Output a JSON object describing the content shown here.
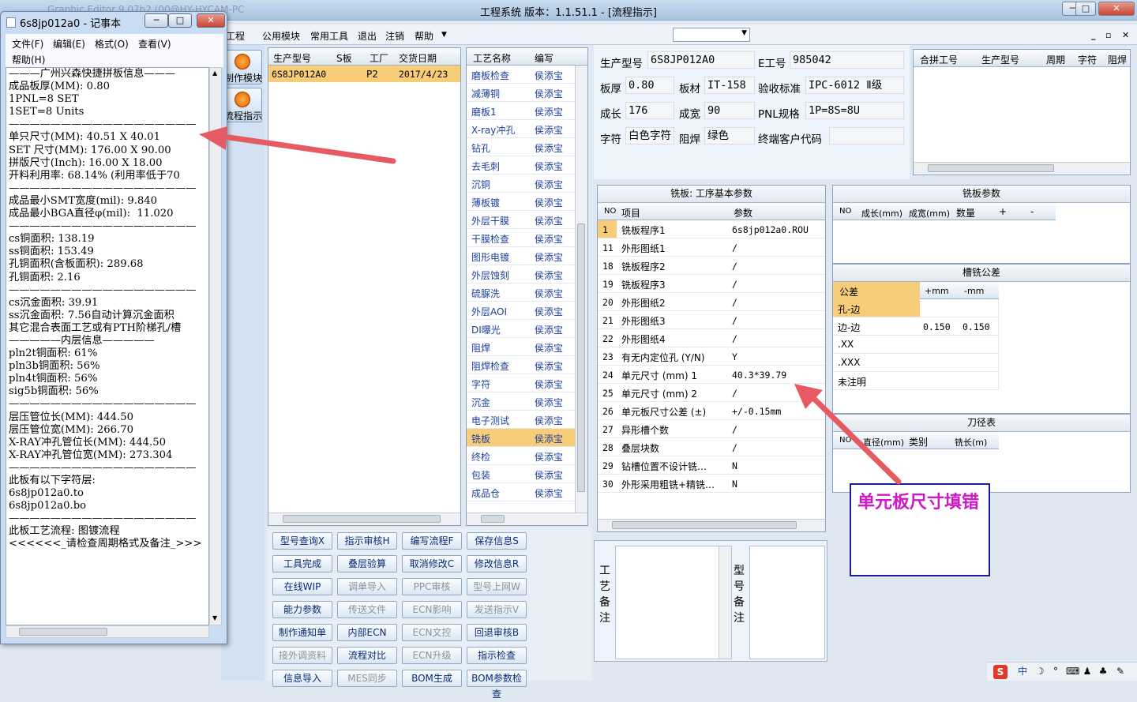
{
  "window": {
    "title": "工程系统   版本：1.1.51.1 - [流程指示]",
    "behind_title": "Graphic Editor 9.07b2 (00@HY-HYCAM-PC"
  },
  "menu": {
    "items": [
      "工程",
      "公用模块",
      "常用工具",
      "退出",
      "注销",
      "帮助"
    ],
    "combo_value": ""
  },
  "notepad": {
    "title": "6s8jp012a0 - 记事本",
    "menu": [
      "文件(F)",
      "编辑(E)",
      "格式(O)",
      "查看(V)",
      "帮助(H)"
    ],
    "lines": [
      "———广州兴森快捷拼板信息———",
      "成品板厚(MM): 0.80",
      "1PNL=8 SET",
      "1SET=8 Units",
      "——————————————————",
      "单只尺寸(MM): 40.51 X 40.01",
      "SET 尺寸(MM): 176.00 X 90.00",
      "拼版尺寸(Inch): 16.00 X 18.00",
      "开料利用率: 68.14% (利用率低于70",
      "——————————————————",
      "成品最小SMT宽度(mil): 9.840",
      "成品最小BGA直径φ(mil):  11.020",
      "——————————————————",
      "cs铜面积: 138.19",
      "ss铜面积: 153.49",
      "孔铜面积(含板面积): 289.68",
      "孔铜面积: 2.16",
      "——————————————————",
      "cs沉金面积: 39.91",
      "ss沉金面积: 7.56自动计算沉金面积",
      "其它混合表面工艺或有PTH阶梯孔/槽",
      "—————内层信息—————",
      "pln2t铜面积: 61%",
      "pln3b铜面积: 56%",
      "pln4t铜面积: 56%",
      "sig5b铜面积: 56%",
      "——————————————————",
      "层压管位长(MM): 444.50",
      "层压管位宽(MM): 266.70",
      "X-RAY冲孔管位长(MM): 444.50",
      "X-RAY冲孔管位宽(MM): 273.304",
      "——————————————————",
      "此板有以下字符层:",
      "6s8jp012a0.to",
      "6s8jp012a0.bo",
      "——————————————————",
      "此板工艺流程: 图镀流程",
      "<<<<<<_请检查周期格式及备注_>>>"
    ]
  },
  "modules": [
    {
      "label": "制作模块"
    },
    {
      "label": "流程指示"
    }
  ],
  "product_grid": {
    "headers": [
      "生产型号",
      "S板",
      "工厂",
      "交货日期"
    ],
    "rows": [
      [
        "6S8JP012A0",
        "",
        "P2",
        "2017/4/23"
      ]
    ]
  },
  "process_grid": {
    "headers": [
      "工艺名称",
      "编写"
    ],
    "rows": [
      [
        "磨板检查",
        "侯添宝"
      ],
      [
        "减薄铜",
        "侯添宝"
      ],
      [
        "磨板1",
        "侯添宝"
      ],
      [
        "X-ray冲孔",
        "侯添宝"
      ],
      [
        "钻孔",
        "侯添宝"
      ],
      [
        "去毛刺",
        "侯添宝"
      ],
      [
        "沉铜",
        "侯添宝"
      ],
      [
        "薄板镀",
        "侯添宝"
      ],
      [
        "外层干膜",
        "侯添宝"
      ],
      [
        "干膜检查",
        "侯添宝"
      ],
      [
        "图形电镀",
        "侯添宝"
      ],
      [
        "外层蚀刻",
        "侯添宝"
      ],
      [
        "硫脲洗",
        "侯添宝"
      ],
      [
        "外层AOI",
        "侯添宝"
      ],
      [
        "DI曝光",
        "侯添宝"
      ],
      [
        "阻焊",
        "侯添宝"
      ],
      [
        "阻焊检查",
        "侯添宝"
      ],
      [
        "字符",
        "侯添宝"
      ],
      [
        "沉金",
        "侯添宝"
      ],
      [
        "电子测试",
        "侯添宝"
      ],
      [
        "铣板",
        "侯添宝"
      ],
      [
        "终检",
        "侯添宝"
      ],
      [
        "包装",
        "侯添宝"
      ],
      [
        "成品仓",
        "侯添宝"
      ]
    ],
    "selected_index": 20
  },
  "buttons": [
    {
      "label": "型号查询X",
      "enabled": true
    },
    {
      "label": "指示审核H",
      "enabled": true
    },
    {
      "label": "编写流程F",
      "enabled": true
    },
    {
      "label": "保存信息S",
      "enabled": true
    },
    {
      "label": "工具完成",
      "enabled": true
    },
    {
      "label": "叠层验算",
      "enabled": true
    },
    {
      "label": "取消修改C",
      "enabled": true
    },
    {
      "label": "修改信息R",
      "enabled": true
    },
    {
      "label": "在线WIP",
      "enabled": true
    },
    {
      "label": "调单导入",
      "enabled": false
    },
    {
      "label": "PPC审核",
      "enabled": false
    },
    {
      "label": "型号上网W",
      "enabled": false
    },
    {
      "label": "能力参数",
      "enabled": true
    },
    {
      "label": "传送文件",
      "enabled": false
    },
    {
      "label": "ECN影响",
      "enabled": false
    },
    {
      "label": "发送指示V",
      "enabled": false
    },
    {
      "label": "制作通知单",
      "enabled": true
    },
    {
      "label": "内部ECN",
      "enabled": true
    },
    {
      "label": "ECN文控",
      "enabled": false
    },
    {
      "label": "回退审核B",
      "enabled": true
    },
    {
      "label": "接外调资料",
      "enabled": false
    },
    {
      "label": "流程对比",
      "enabled": true
    },
    {
      "label": "ECN升级",
      "enabled": false
    },
    {
      "label": "指示检查",
      "enabled": true
    },
    {
      "label": "信息导入",
      "enabled": true
    },
    {
      "label": "MES同步",
      "enabled": false
    },
    {
      "label": "BOM生成",
      "enabled": true
    },
    {
      "label": "BOM参数检查",
      "enabled": true
    }
  ],
  "info": {
    "model_lbl": "生产型号",
    "model": "6S8JP012A0",
    "job_lbl": "E工号",
    "job": "985042",
    "thick_lbl": "板厚",
    "thick": "0.80",
    "mat_lbl": "板材",
    "mat": "IT-158",
    "std_lbl": "验收标准",
    "std": "IPC-6012 Ⅱ级",
    "len_lbl": "成长",
    "len": "176",
    "wid_lbl": "成宽",
    "wid": "90",
    "pnl_lbl": "PNL规格",
    "pnl": "1P=8S=8U",
    "char_lbl": "字符",
    "char": "白色字符",
    "mask_lbl": "阻焊",
    "mask": "绿色",
    "cust_lbl": "终端客户代码",
    "cust": ""
  },
  "merge_grid": {
    "headers": [
      "合拼工号",
      "生产型号",
      "周期",
      "字符",
      "阻焊"
    ]
  },
  "param_grid": {
    "title": "铣板: 工序基本参数",
    "headers": [
      "NO",
      "项目",
      "参数"
    ],
    "rows": [
      [
        "1",
        "铣板程序1",
        "6s8jp012a0.ROU"
      ],
      [
        "11",
        "外形图纸1",
        "/"
      ],
      [
        "18",
        "铣板程序2",
        "/"
      ],
      [
        "19",
        "铣板程序3",
        "/"
      ],
      [
        "20",
        "外形图纸2",
        "/"
      ],
      [
        "21",
        "外形图纸3",
        "/"
      ],
      [
        "22",
        "外形图纸4",
        "/"
      ],
      [
        "23",
        "有无内定位孔 (Y/N)",
        "Y"
      ],
      [
        "24",
        "单元尺寸 (mm) 1",
        "40.3*39.79"
      ],
      [
        "25",
        "单元尺寸 (mm) 2",
        "/"
      ],
      [
        "26",
        "单元板尺寸公差 (±)",
        "+/-0.15mm"
      ],
      [
        "27",
        "异形槽个数",
        "/"
      ],
      [
        "28",
        "叠层块数",
        "/"
      ],
      [
        "29",
        "钻槽位置不设计铣…",
        "N"
      ],
      [
        "30",
        "外形采用粗铣+精铣…",
        "N"
      ]
    ]
  },
  "mill_params": {
    "title": "铣板参数",
    "headers": [
      "NO",
      "成长(mm)",
      "成宽(mm)",
      "数量",
      "+",
      "-"
    ]
  },
  "tolerance": {
    "title": "槽铣公差",
    "headers": [
      "公差",
      "+mm",
      "-mm"
    ],
    "rows": [
      [
        "孔-边",
        "",
        ""
      ],
      [
        "边-边",
        "0.150",
        "0.150"
      ],
      [
        ".XX",
        "",
        ""
      ],
      [
        ".XXX",
        "",
        ""
      ],
      [
        "未注明",
        "",
        ""
      ]
    ]
  },
  "tools": {
    "title": "刀径表",
    "headers": [
      "NO",
      "直径(mm)",
      "类别",
      "铣长(m)"
    ]
  },
  "notes": {
    "process_label": "工艺备注",
    "model_label": "型号备注"
  },
  "annotation": {
    "text": "单元板尺寸填错",
    "color": "#d018c8"
  },
  "tray": {
    "ime": "中"
  }
}
